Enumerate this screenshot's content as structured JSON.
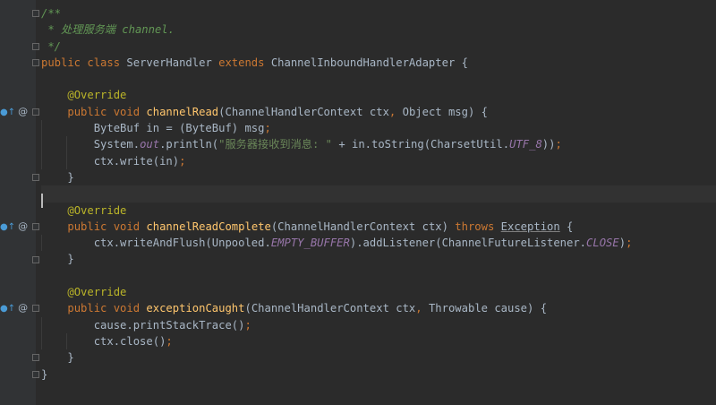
{
  "editor": {
    "lines": [
      [
        {
          "c": "cmt",
          "t": "/**"
        }
      ],
      [
        {
          "c": "cmt",
          "t": " * 处理服务端 channel."
        }
      ],
      [
        {
          "c": "cmt",
          "t": " */"
        }
      ],
      [
        {
          "c": "kw",
          "t": "public class "
        },
        {
          "c": "plain",
          "t": "ServerHandler "
        },
        {
          "c": "kw",
          "t": "extends "
        },
        {
          "c": "plain",
          "t": "ChannelInboundHandlerAdapter {"
        }
      ],
      [],
      [
        {
          "c": "plain",
          "t": "    "
        },
        {
          "c": "ann",
          "t": "@Override"
        }
      ],
      [
        {
          "c": "plain",
          "t": "    "
        },
        {
          "c": "kw",
          "t": "public void "
        },
        {
          "c": "fn",
          "t": "channelRead"
        },
        {
          "c": "plain",
          "t": "(ChannelHandlerContext ctx"
        },
        {
          "c": "kw",
          "t": ", "
        },
        {
          "c": "plain",
          "t": "Object msg) {"
        }
      ],
      [
        {
          "c": "plain",
          "t": "        ByteBuf in = (ByteBuf) msg"
        },
        {
          "c": "kw",
          "t": ";"
        }
      ],
      [
        {
          "c": "plain",
          "t": "        System."
        },
        {
          "c": "stat",
          "t": "out"
        },
        {
          "c": "plain",
          "t": ".println("
        },
        {
          "c": "str",
          "t": "\"服务器接收到消息: \""
        },
        {
          "c": "plain",
          "t": " + in.toString(CharsetUtil."
        },
        {
          "c": "stat",
          "t": "UTF_8"
        },
        {
          "c": "plain",
          "t": "))"
        },
        {
          "c": "kw",
          "t": ";"
        }
      ],
      [
        {
          "c": "plain",
          "t": "        ctx.write(in)"
        },
        {
          "c": "kw",
          "t": ";"
        }
      ],
      [
        {
          "c": "plain",
          "t": "    }"
        }
      ],
      [],
      [
        {
          "c": "plain",
          "t": "    "
        },
        {
          "c": "ann",
          "t": "@Override"
        }
      ],
      [
        {
          "c": "plain",
          "t": "    "
        },
        {
          "c": "kw",
          "t": "public void "
        },
        {
          "c": "fn",
          "t": "channelReadComplete"
        },
        {
          "c": "plain",
          "t": "(ChannelHandlerContext ctx) "
        },
        {
          "c": "kw",
          "t": "throws "
        },
        {
          "c": "warn",
          "t": "Exception"
        },
        {
          "c": "plain",
          "t": " {"
        }
      ],
      [
        {
          "c": "plain",
          "t": "        ctx.writeAndFlush(Unpooled."
        },
        {
          "c": "stat",
          "t": "EMPTY_BUFFER"
        },
        {
          "c": "plain",
          "t": ").addListener(ChannelFutureListener."
        },
        {
          "c": "stat",
          "t": "CLOSE"
        },
        {
          "c": "plain",
          "t": ")"
        },
        {
          "c": "kw",
          "t": ";"
        }
      ],
      [
        {
          "c": "plain",
          "t": "    }"
        }
      ],
      [],
      [
        {
          "c": "plain",
          "t": "    "
        },
        {
          "c": "ann",
          "t": "@Override"
        }
      ],
      [
        {
          "c": "plain",
          "t": "    "
        },
        {
          "c": "kw",
          "t": "public void "
        },
        {
          "c": "fn",
          "t": "exceptionCaught"
        },
        {
          "c": "plain",
          "t": "(ChannelHandlerContext ctx"
        },
        {
          "c": "kw",
          "t": ", "
        },
        {
          "c": "plain",
          "t": "Throwable cause) {"
        }
      ],
      [
        {
          "c": "plain",
          "t": "        cause.printStackTrace()"
        },
        {
          "c": "kw",
          "t": ";"
        }
      ],
      [
        {
          "c": "plain",
          "t": "        ctx.close()"
        },
        {
          "c": "kw",
          "t": ";"
        }
      ],
      [
        {
          "c": "plain",
          "t": "    }"
        }
      ],
      [
        {
          "c": "plain",
          "t": "}"
        }
      ]
    ],
    "gutter_markers": [
      {
        "line": 6,
        "icon": "override-method-icon",
        "glyph": "●↑",
        "at": "@"
      },
      {
        "line": 13,
        "icon": "override-method-icon",
        "glyph": "●↑",
        "at": "@"
      },
      {
        "line": 18,
        "icon": "override-method-icon",
        "glyph": "●↑",
        "at": "@"
      }
    ],
    "fold_lines": [
      0,
      2,
      3,
      6,
      10,
      13,
      15,
      18,
      21,
      22
    ],
    "caret_line": 11,
    "colors": {
      "background": "#2b2b2b",
      "gutter": "#313335",
      "keyword": "#cc7832",
      "comment": "#629755",
      "annotation": "#bbb529",
      "function": "#ffc66d",
      "string": "#6a8759",
      "static": "#9876aa",
      "text": "#a9b7c6"
    }
  }
}
